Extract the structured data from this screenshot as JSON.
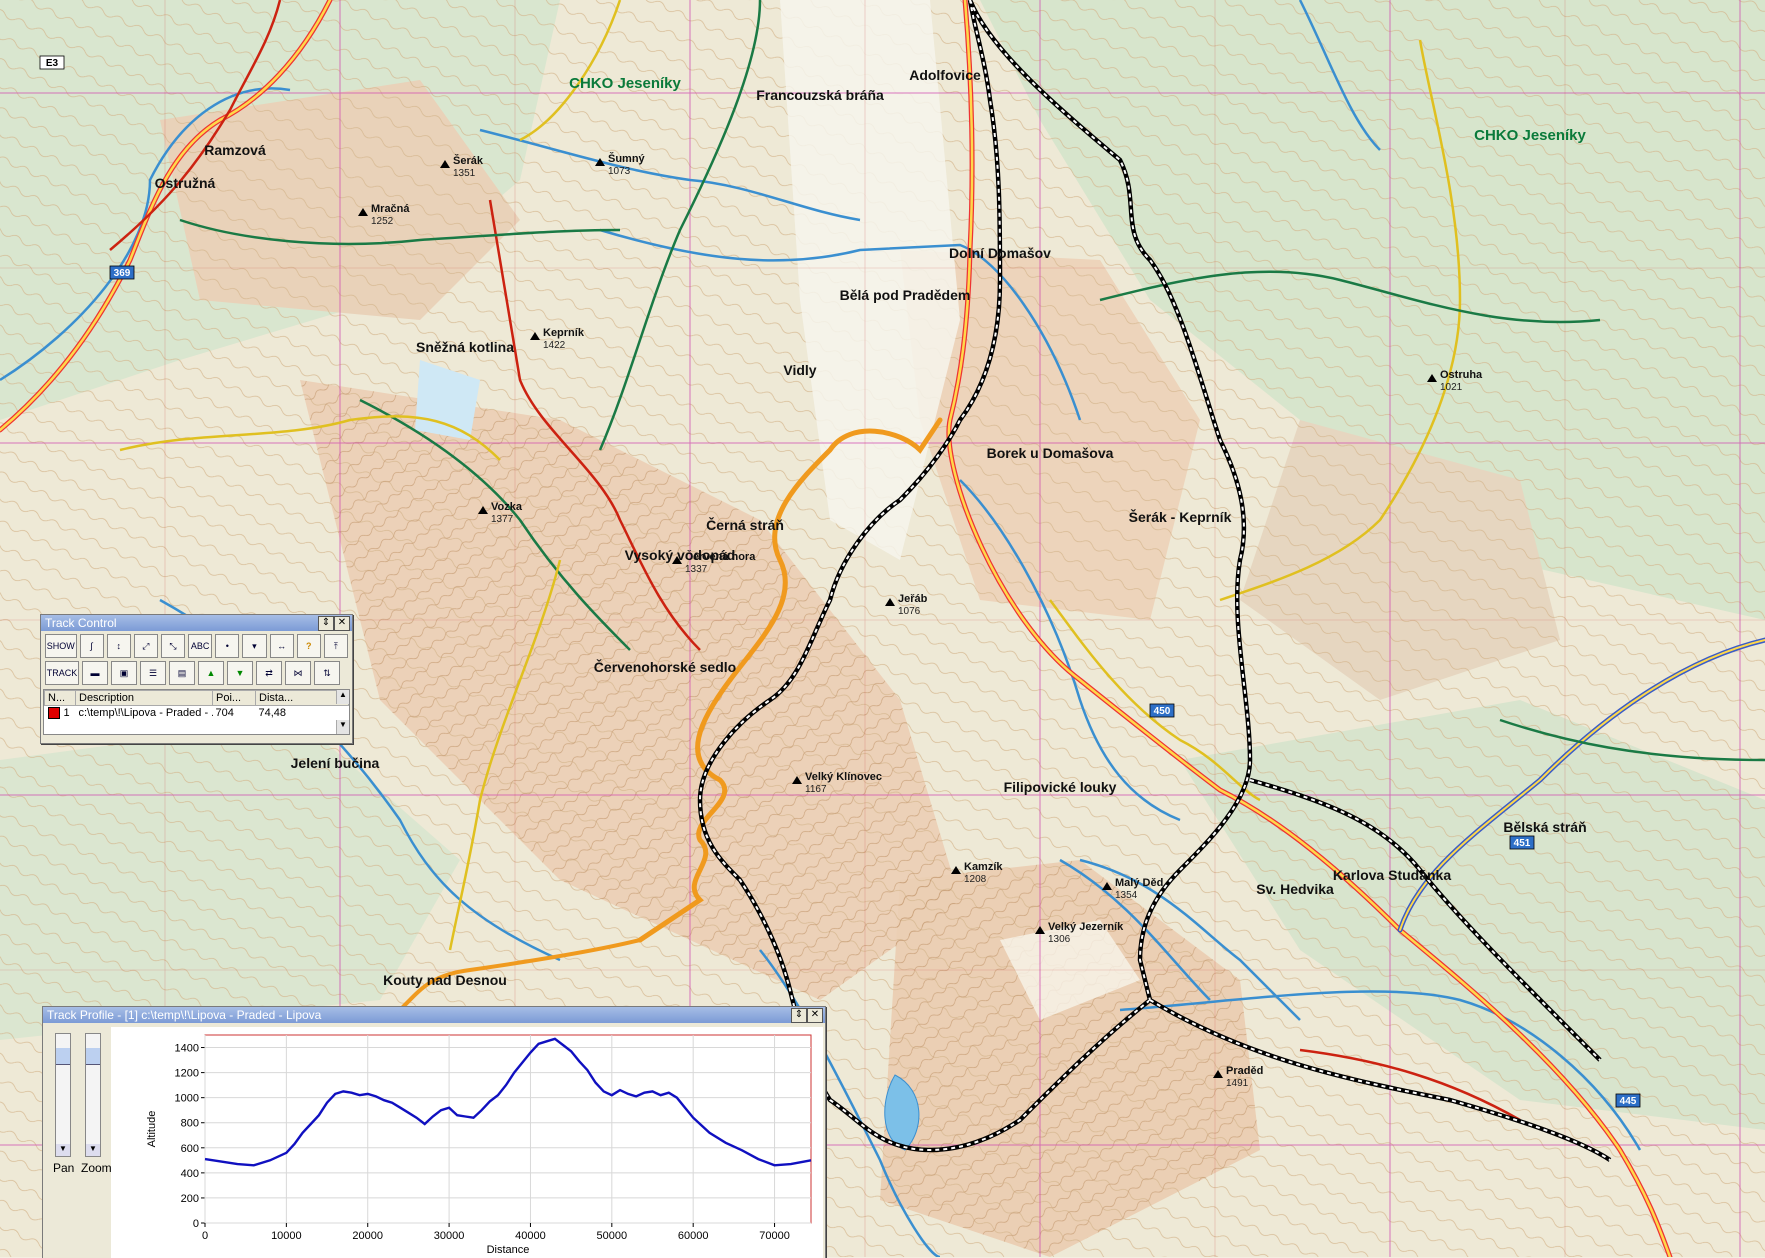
{
  "map": {
    "protected_area_label": "CHKO Jeseníky",
    "peaks": [
      {
        "name": "Praděd",
        "elev": "1491"
      },
      {
        "name": "Keprník",
        "elev": "1422"
      },
      {
        "name": "Šerák",
        "elev": "1351"
      },
      {
        "name": "Červená hora",
        "elev": "1337"
      },
      {
        "name": "Velký Klínovec",
        "elev": "1167"
      },
      {
        "name": "Kamzík",
        "elev": "1208"
      },
      {
        "name": "Malý Děd",
        "elev": "1354"
      },
      {
        "name": "Vozka",
        "elev": "1377"
      },
      {
        "name": "Šumný",
        "elev": "1073"
      },
      {
        "name": "Ostruha",
        "elev": "1021"
      },
      {
        "name": "Velký Jezerník",
        "elev": "1306"
      },
      {
        "name": "Mračná",
        "elev": "1252"
      },
      {
        "name": "Jeřáb",
        "elev": "1076"
      }
    ],
    "places": [
      {
        "name": "Červenohorské sedlo"
      },
      {
        "name": "Bělá pod Pradědem"
      },
      {
        "name": "Ostružná"
      },
      {
        "name": "Kouty nad Desnou"
      },
      {
        "name": "Ramzová"
      },
      {
        "name": "Dolní Domašov"
      },
      {
        "name": "Adolfovice"
      },
      {
        "name": "Sv. Hedvika"
      },
      {
        "name": "Karlova Studánka"
      },
      {
        "name": "Vidly"
      },
      {
        "name": "Filipovické louky"
      },
      {
        "name": "Vysoký vodopád"
      },
      {
        "name": "Sněžná kotlina"
      },
      {
        "name": "Šerák - Keprník"
      },
      {
        "name": "Borek u Domašova"
      },
      {
        "name": "Bělská stráň"
      },
      {
        "name": "Jelení bučina"
      },
      {
        "name": "Černá stráň"
      },
      {
        "name": "Francouzská bráña"
      }
    ],
    "route_labels": [
      "E3",
      "369",
      "450",
      "451",
      "445"
    ]
  },
  "track_control": {
    "title": "Track Control",
    "tools_row1": [
      "SHOW",
      "",
      "",
      "",
      "",
      "ABC",
      "",
      "",
      "",
      "?",
      ""
    ],
    "tools_row2": [
      "TRACK",
      "",
      "",
      "",
      "",
      "",
      "",
      "",
      "",
      "",
      ""
    ],
    "columns": [
      "N...",
      "Description",
      "Poi...",
      "Dista..."
    ],
    "rows": [
      {
        "n": "1",
        "description": "c:\\temp\\!\\Lipova - Praded - ...",
        "points": "704",
        "distance": "74,48",
        "color": "#e00000"
      }
    ]
  },
  "track_profile": {
    "title": "Track Profile - [1] c:\\temp\\!\\Lipova - Praded - Lipova",
    "pan_label": "Pan",
    "zoom_label": "Zoom"
  },
  "chart_data": {
    "type": "line",
    "xlabel": "Distance",
    "ylabel": "Altitude",
    "xlim": [
      0,
      74480
    ],
    "ylim": [
      0,
      1500
    ],
    "xticks": [
      0,
      10000,
      20000,
      30000,
      40000,
      50000,
      60000,
      70000
    ],
    "yticks": [
      0,
      200,
      400,
      600,
      800,
      1000,
      1200,
      1400
    ],
    "series": [
      {
        "color": "#1010c0",
        "x": [
          0,
          2000,
          4000,
          6000,
          8000,
          10000,
          11000,
          12000,
          13000,
          14000,
          15000,
          16000,
          17000,
          18000,
          19000,
          20000,
          21000,
          22000,
          23000,
          24000,
          25000,
          26000,
          27000,
          28000,
          29000,
          30000,
          31000,
          32000,
          33000,
          34000,
          35000,
          36000,
          37000,
          38000,
          39000,
          40000,
          41000,
          42000,
          43000,
          44000,
          45000,
          46000,
          47000,
          48000,
          49000,
          50000,
          51000,
          52000,
          53000,
          54000,
          55000,
          56000,
          57000,
          58000,
          59000,
          60000,
          62000,
          64000,
          66000,
          68000,
          70000,
          72000,
          74480
        ],
        "y": [
          510,
          490,
          470,
          460,
          500,
          560,
          630,
          720,
          790,
          860,
          960,
          1030,
          1050,
          1040,
          1020,
          1030,
          1010,
          980,
          960,
          920,
          880,
          840,
          790,
          850,
          900,
          920,
          860,
          850,
          840,
          900,
          970,
          1020,
          1100,
          1200,
          1280,
          1360,
          1430,
          1450,
          1470,
          1420,
          1370,
          1290,
          1220,
          1120,
          1050,
          1020,
          1060,
          1030,
          1010,
          1040,
          1050,
          1020,
          1040,
          1000,
          920,
          840,
          720,
          640,
          580,
          510,
          460,
          470,
          500
        ]
      }
    ]
  }
}
